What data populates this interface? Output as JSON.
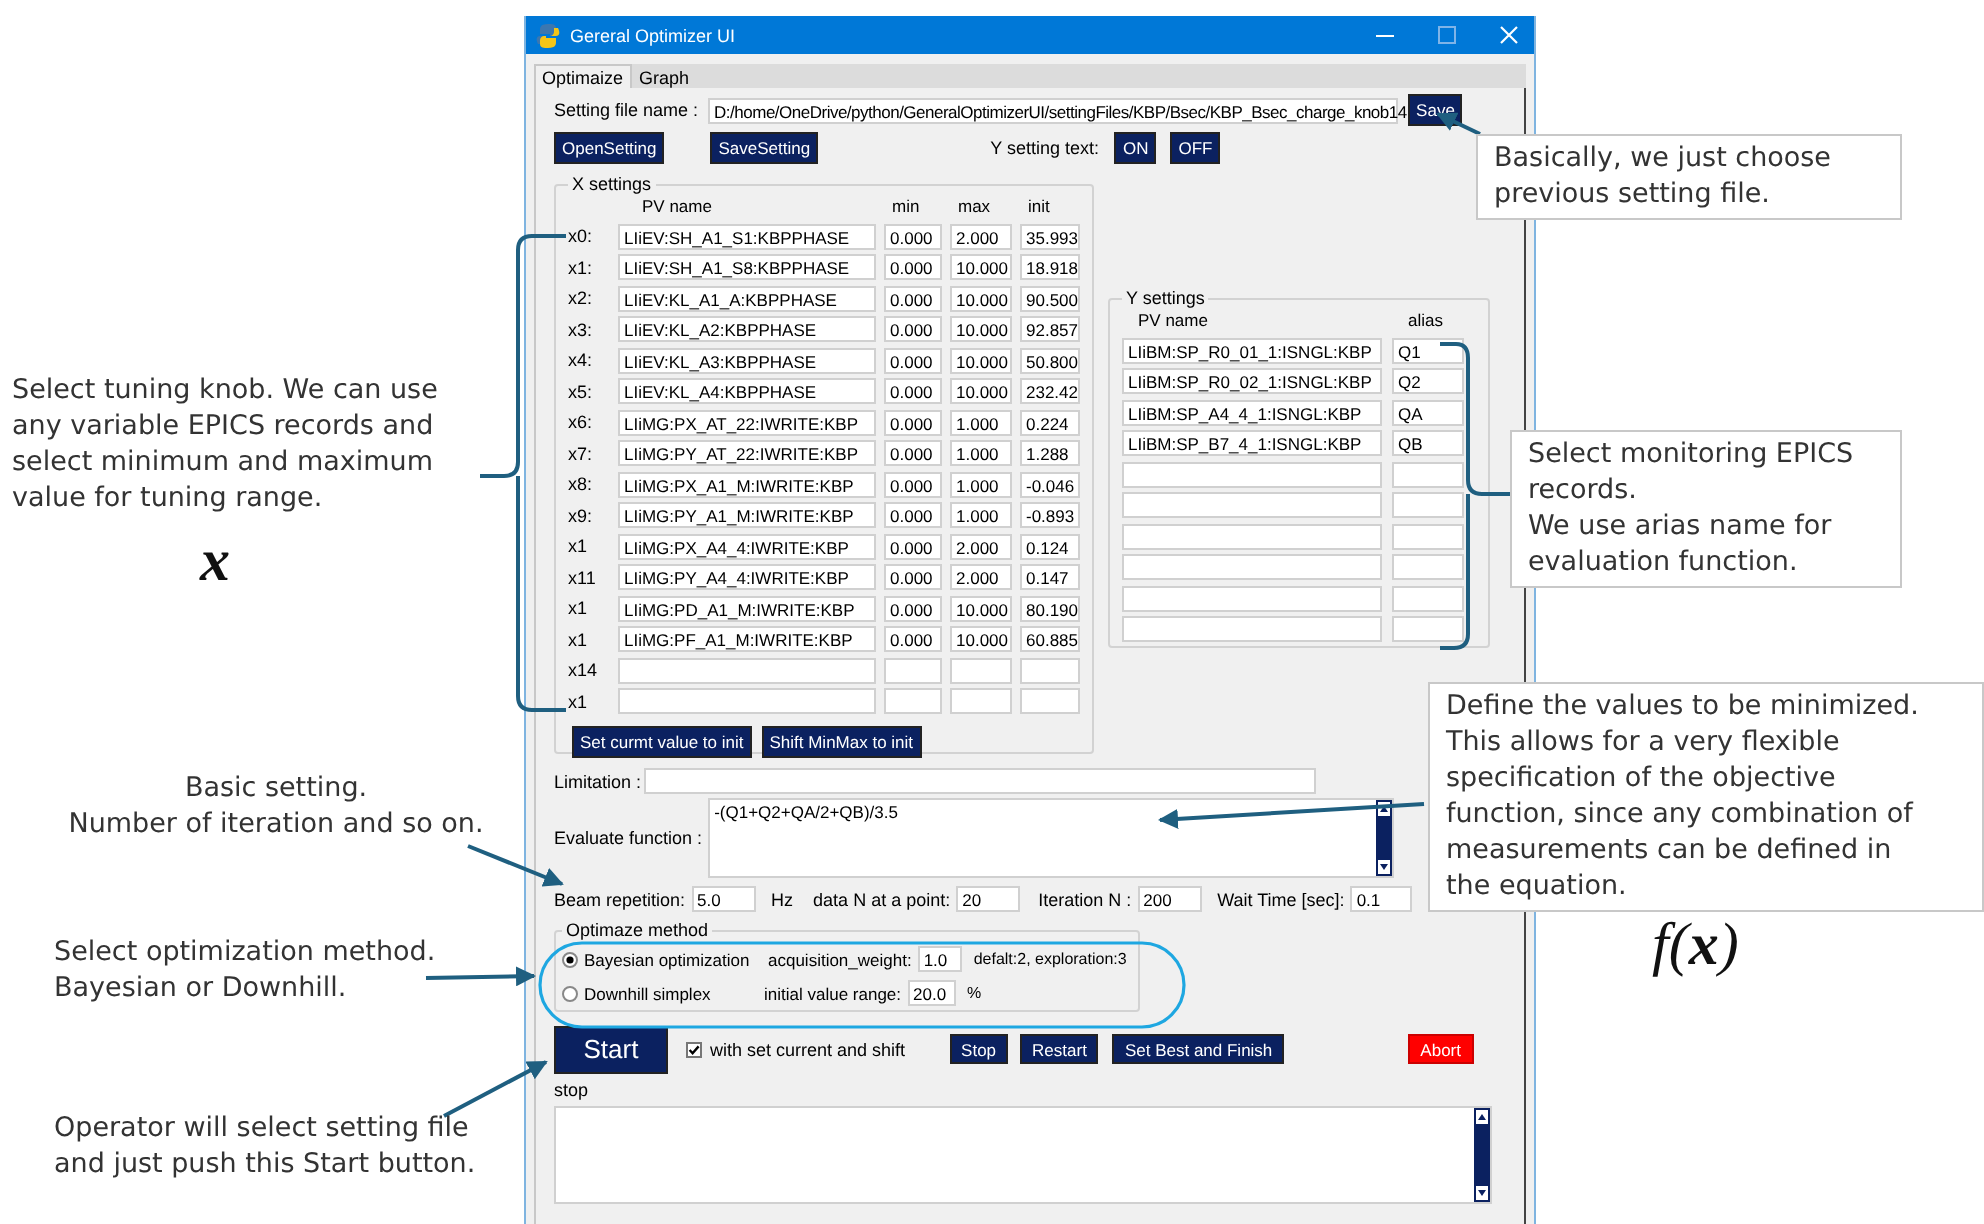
{
  "window": {
    "title": "Gereral Optimizer UI"
  },
  "tabs": [
    {
      "label": "Optimaize",
      "selected": true
    },
    {
      "label": "Graph",
      "selected": false
    }
  ],
  "setting_file": {
    "label": "Setting file name :",
    "value": "D:/home/OneDrive/python/GeneralOptimizerUI/settingFiles/KBP/Bsec/KBP_Bsec_charge_knob14",
    "save_button": "Save"
  },
  "file_buttons": [
    "OpenSetting",
    "SaveSetting"
  ],
  "y_setting_text": {
    "label": "Y setting text:",
    "buttons": [
      "ON",
      "OFF"
    ]
  },
  "x_settings": {
    "title": "X settings",
    "columns": [
      "PV name",
      "min",
      "max",
      "init"
    ],
    "rows": [
      {
        "label": "x0:",
        "pv": "LIiEV:SH_A1_S1:KBPPHASE",
        "min": "0.000",
        "max": "2.000",
        "init": "35.993"
      },
      {
        "label": "x1:",
        "pv": "LIiEV:SH_A1_S8:KBPPHASE",
        "min": "0.000",
        "max": "10.000",
        "init": "18.918"
      },
      {
        "label": "x2:",
        "pv": "LIiEV:KL_A1_A:KBPPHASE",
        "min": "0.000",
        "max": "10.000",
        "init": "90.500"
      },
      {
        "label": "x3:",
        "pv": "LIiEV:KL_A2:KBPPHASE",
        "min": "0.000",
        "max": "10.000",
        "init": "92.857"
      },
      {
        "label": "x4:",
        "pv": "LIiEV:KL_A3:KBPPHASE",
        "min": "0.000",
        "max": "10.000",
        "init": "50.800"
      },
      {
        "label": "x5:",
        "pv": "LIiEV:KL_A4:KBPPHASE",
        "min": "0.000",
        "max": "10.000",
        "init": "232.42"
      },
      {
        "label": "x6:",
        "pv": "LIiMG:PX_AT_22:IWRITE:KBP",
        "min": "0.000",
        "max": "1.000",
        "init": "0.224"
      },
      {
        "label": "x7:",
        "pv": "LIiMG:PY_AT_22:IWRITE:KBP",
        "min": "0.000",
        "max": "1.000",
        "init": "1.288"
      },
      {
        "label": "x8:",
        "pv": "LIiMG:PX_A1_M:IWRITE:KBP",
        "min": "0.000",
        "max": "1.000",
        "init": "-0.046"
      },
      {
        "label": "x9:",
        "pv": "LIiMG:PY_A1_M:IWRITE:KBP",
        "min": "0.000",
        "max": "1.000",
        "init": "-0.893"
      },
      {
        "label": "x1",
        "pv": "LIiMG:PX_A4_4:IWRITE:KBP",
        "min": "0.000",
        "max": "2.000",
        "init": "0.124"
      },
      {
        "label": "x11",
        "pv": "LIiMG:PY_A4_4:IWRITE:KBP",
        "min": "0.000",
        "max": "2.000",
        "init": "0.147"
      },
      {
        "label": "x1",
        "pv": "LIiMG:PD_A1_M:IWRITE:KBP",
        "min": "0.000",
        "max": "10.000",
        "init": "80.190"
      },
      {
        "label": "x1",
        "pv": "LIiMG:PF_A1_M:IWRITE:KBP",
        "min": "0.000",
        "max": "10.000",
        "init": "60.885"
      },
      {
        "label": "x14"
      },
      {
        "label": "x1"
      }
    ],
    "buttons": [
      "Set curmt value to init",
      "Shift MinMax to init"
    ]
  },
  "y_settings": {
    "title": "Y settings",
    "columns": [
      "PV name",
      "alias"
    ],
    "rows": [
      {
        "pv": "LIiBM:SP_R0_01_1:ISNGL:KBP",
        "alias": "Q1"
      },
      {
        "pv": "LIiBM:SP_R0_02_1:ISNGL:KBP",
        "alias": "Q2"
      },
      {
        "pv": "LIiBM:SP_A4_4_1:ISNGL:KBP",
        "alias": "QA"
      },
      {
        "pv": "LIiBM:SP_B7_4_1:ISNGL:KBP",
        "alias": "QB"
      },
      {},
      {},
      {},
      {},
      {},
      {}
    ]
  },
  "limitation": {
    "label": "Limitation :"
  },
  "evaluate_function": {
    "label": "Evaluate function :",
    "value": "-(Q1+Q2+QA/2+QB)/3.5"
  },
  "parameters": [
    {
      "label": "Beam repetition:",
      "value": "5.0",
      "unit": "Hz"
    },
    {
      "label": "data N at a point:",
      "value": "20"
    },
    {
      "label": "Iteration N :",
      "value": "200"
    },
    {
      "label": "Wait Time [sec]:",
      "value": "0.1"
    }
  ],
  "optimize_method": {
    "title": "Optimaze method",
    "options": [
      {
        "label": "Bayesian optimization",
        "selected": true,
        "param_label": "acquisition_weight:",
        "param_value": "1.0",
        "note": "defalt:2, exploration:3"
      },
      {
        "label": "Downhill simplex",
        "selected": false,
        "param_label": "initial value range:",
        "param_value": "20.0",
        "note": "%"
      }
    ]
  },
  "start_button": "Start",
  "with_set_current": {
    "label": "with set current and shift",
    "checked": true
  },
  "action_buttons": [
    {
      "label": "Stop",
      "kind": "normal"
    },
    {
      "label": "Restart",
      "kind": "normal"
    },
    {
      "label": "Set Best and Finish",
      "kind": "normal"
    },
    {
      "label": "Abort",
      "kind": "danger"
    }
  ],
  "status": "stop",
  "annotations": [
    {
      "kind": "note",
      "framed": true,
      "lines": [
        "Basically, we just choose",
        "previous setting file."
      ]
    },
    {
      "kind": "note",
      "framed": true,
      "lines": [
        "Select monitoring EPICS",
        "records.",
        "We use arias name for",
        "evaluation function."
      ]
    },
    {
      "kind": "note",
      "framed": true,
      "lines": [
        "Define the values to be minimized.",
        "This allows for a very flexible",
        "specification of the objective",
        "function, since any combination of",
        "measurements can be defined in",
        "the equation."
      ]
    },
    {
      "kind": "formula",
      "text": "*f*(**x**)"
    },
    {
      "kind": "note",
      "framed": false,
      "lines": [
        "Select tuning knob. We can use",
        "any variable EPICS records and",
        "select minimum and maximum",
        "value for tuning range."
      ]
    },
    {
      "kind": "symbol",
      "text": "x"
    },
    {
      "kind": "note",
      "framed": false,
      "lines": [
        "Basic setting.",
        "Number of iteration and so on."
      ]
    },
    {
      "kind": "note",
      "framed": false,
      "lines": [
        "Select optimization method.",
        "Bayesian or Downhill."
      ]
    },
    {
      "kind": "note",
      "framed": false,
      "lines": [
        "Operator will select setting file",
        "and just push this Start button."
      ]
    }
  ]
}
